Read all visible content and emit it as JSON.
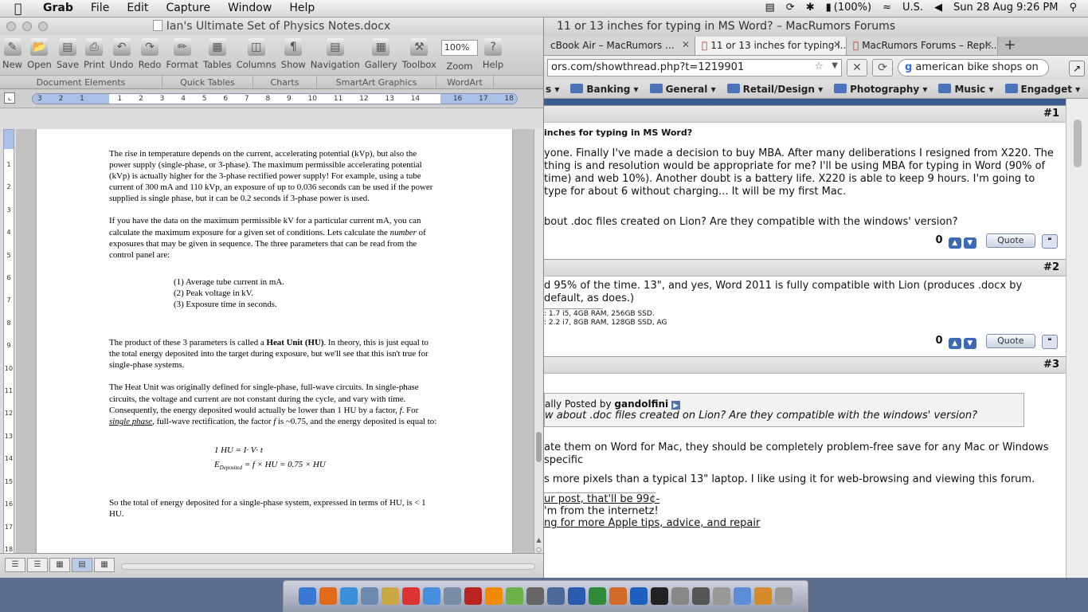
{
  "menubar": {
    "apple": "",
    "app": "Grab",
    "items": [
      "File",
      "Edit",
      "Capture",
      "Window",
      "Help"
    ],
    "status": [
      "(100%)",
      "U.S.",
      "Sun 28 Aug  9:26 PM"
    ]
  },
  "word": {
    "title": "Ian's Ultimate Set of Physics Notes.docx",
    "toolbar": [
      {
        "label": "New",
        "icon": "new-icon"
      },
      {
        "label": "Open",
        "icon": "open-icon"
      },
      {
        "label": "Save",
        "icon": "save-icon"
      },
      {
        "label": "Print",
        "icon": "print-icon"
      },
      {
        "label": "Undo",
        "icon": "undo-icon"
      },
      {
        "label": "Redo",
        "icon": "redo-icon"
      },
      {
        "label": "Format",
        "icon": "format-icon"
      },
      {
        "label": "Tables",
        "icon": "tables-icon"
      },
      {
        "label": "Columns",
        "icon": "columns-icon"
      },
      {
        "label": "Show",
        "icon": "pilcrow-icon"
      },
      {
        "label": "Navigation",
        "icon": "navigation-icon"
      },
      {
        "label": "Gallery",
        "icon": "gallery-icon"
      },
      {
        "label": "Toolbox",
        "icon": "toolbox-icon"
      },
      {
        "label": "Zoom",
        "icon": "zoom-icon"
      },
      {
        "label": "Help",
        "icon": "help-icon"
      }
    ],
    "zoom": "100%",
    "ribbon": [
      "Document Elements",
      "Quick Tables",
      "Charts",
      "SmartArt Graphics",
      "WordArt"
    ],
    "ruler_numbers": [
      "3",
      "2",
      "1",
      "",
      "1",
      "2",
      "3",
      "4",
      "5",
      "6",
      "7",
      "8",
      "9",
      "10",
      "11",
      "12",
      "13",
      "14",
      "",
      "16",
      "17",
      "18"
    ],
    "vruler_numbers": [
      "1",
      "2",
      "3",
      "4",
      "5",
      "6",
      "7",
      "8",
      "9",
      "10",
      "11",
      "12",
      "13",
      "14",
      "15",
      "16",
      "17",
      "18"
    ],
    "doc": {
      "p1": "The rise in temperature depends on the current, accelerating potential (kVp), but also the power supply (single-phase, or 3-phase).  The maximum permissible accelerating potential (kVp) is actually higher for the 3-phase rectified power supply!  For example, using a tube current of 300 mA and 110 kVp, an exposure of up to 0.036 seconds can be used if the power supplied is single phase, but it can be 0.2 seconds if 3-phase power is used.",
      "p2a": "If you have the data on the maximum permissible kV for a particular current mA, you can calculate the maximum exposure for a given set of conditions.   Lets calculate the ",
      "p2b": "number",
      "p2c": " of exposures that may be given in sequence.  The three parameters that can be read from the control panel are:",
      "list": [
        "(1) Average tube current in mA.",
        "(2) Peak voltage in kV.",
        "(3) Exposure time in seconds."
      ],
      "p3a": "The product of these 3 parameters is called a ",
      "p3b": "Heat Unit (HU)",
      "p3c": ". In theory, this is just equal to the total energy deposited into the target during exposure, but we'll see that this isn't true for single-phase systems.",
      "p4a": " The Heat Unit was originally defined for single-phase, full-wave circuits.  In single-phase circuits, the voltage and current are not constant during the cycle, and vary with time.  Consequently, the energy deposited would actually be lower than 1 HU by a factor, ",
      "p4b": "f",
      "p4c": ".  For ",
      "p4d": "single phase",
      "p4e": ", full-wave rectification, the factor ",
      "p4f": "f",
      "p4g": " is ~0.75, and the energy deposited is equal to:",
      "eq1": "1 HU = I· V· t",
      "eq2a": "E",
      "eq2sub": "Deposited",
      "eq2b": " = f × HU = 0.75 × HU",
      "p5": "So the total of energy deposited for a single-phase system, expressed in terms of HU, is < 1 HU."
    }
  },
  "browser": {
    "title": "11 or 13 inches for typing in MS Word? – MacRumors Forums",
    "tabs": [
      {
        "label": "cBook Air – MacRumors ...",
        "active": false
      },
      {
        "label": "11 or 13 inches for typing i...",
        "active": true
      },
      {
        "label": "MacRumors Forums – Repl...",
        "active": false
      }
    ],
    "url": "ors.com/showthread.php?t=1219901",
    "search": "american bike shops on",
    "bookmarks": [
      "s",
      "Banking",
      "General",
      "Retail/Design",
      "Photography",
      "Music",
      "Engadget"
    ],
    "posts": [
      {
        "number": "#1",
        "title": "inches for typing in MS Word?",
        "body": [
          "yone. Finally I've made a decision to buy MBA. After many deliberations I resigned from X220. The thing is and resolution would be appropriate for me? I'll be using MBA for typing in Word (90% of time) and web 10%). Another doubt is a battery life. X220 is able to keep 9 hours. I'm going to type for about 6 without charging... It will be my first Mac.",
          "bout .doc files created on Lion? Are they compatible with the windows' version?"
        ],
        "count": "0",
        "quote": "Quote"
      },
      {
        "number": "#2",
        "body": [
          "d 95% of the time. 13\", and yes, Word 2011 is fully compatible with Lion (produces .docx by default, as does.)"
        ],
        "sig": [
          ": 1.7 i5, 4GB RAM, 256GB SSD.",
          ": 2.2 i7, 8GB RAM, 128GB SSD, AG"
        ],
        "count": "0",
        "quote": "Quote"
      },
      {
        "number": "#3",
        "quote_head": "ally Posted by ",
        "quote_author": "gandolfini",
        "quote_text": "w about .doc files created on Lion? Are they compatible with the windows' version?",
        "body": [
          "ate them on Word for Mac, they should be completely problem-free save for any Mac or Windows specific",
          "s more pixels than a typical 13\" laptop. I like using it for web-browsing and viewing this forum."
        ],
        "sig": [
          "ur post, that'll be 99¢-",
          "'m from the internetz!",
          "ng for more Apple tips, advice, and repair"
        ]
      }
    ]
  },
  "dock": {
    "apps": [
      {
        "name": "finder",
        "color": "#3a78d4"
      },
      {
        "name": "firefox",
        "color": "#e06a1a"
      },
      {
        "name": "safari",
        "color": "#3a8fd8"
      },
      {
        "name": "preview",
        "color": "#6a8ab0"
      },
      {
        "name": "notes",
        "color": "#c9a845"
      },
      {
        "name": "calendar",
        "color": "#d33"
      },
      {
        "name": "itunes",
        "color": "#4a8ee0"
      },
      {
        "name": "mail",
        "color": "#7a8da8"
      },
      {
        "name": "photobooth",
        "color": "#b22"
      },
      {
        "name": "vlc",
        "color": "#f08a00"
      },
      {
        "name": "textedit",
        "color": "#6cb04a"
      },
      {
        "name": "tools",
        "color": "#666"
      },
      {
        "name": "xcode",
        "color": "#4a6a9a"
      },
      {
        "name": "word",
        "color": "#2a5bb0"
      },
      {
        "name": "excel",
        "color": "#2f8a3a"
      },
      {
        "name": "powerpoint",
        "color": "#d46a2a"
      },
      {
        "name": "outlook",
        "color": "#1d5fbf"
      },
      {
        "name": "terminal",
        "color": "#222"
      },
      {
        "name": "settings",
        "color": "#888"
      },
      {
        "name": "utility",
        "color": "#555"
      },
      {
        "name": "grab",
        "color": "#999"
      },
      {
        "name": "folder",
        "color": "#5a8ed6"
      },
      {
        "name": "downloads",
        "color": "#d48a2a"
      },
      {
        "name": "trash",
        "color": "#9a9a9a"
      }
    ]
  }
}
